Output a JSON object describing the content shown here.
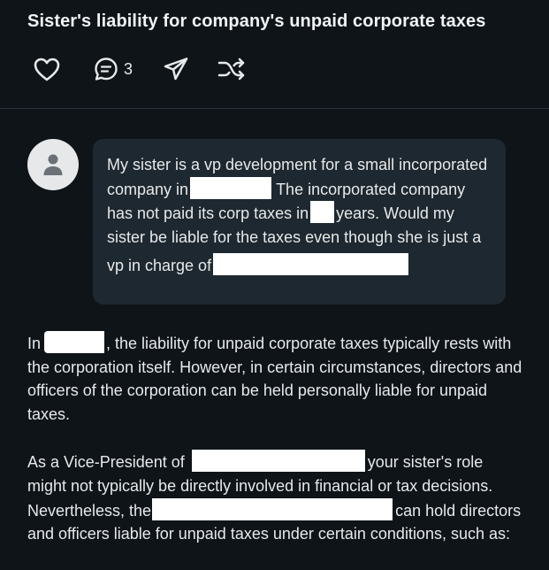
{
  "header": {
    "title": "Sister's liability for company's unpaid corporate taxes",
    "actions": {
      "like_icon": "heart-icon",
      "comment_icon": "comment-bubble-icon",
      "comment_count": "3",
      "share_icon": "send-icon",
      "alt_icon": "shuffle-icon"
    }
  },
  "question": {
    "avatar_icon": "user-icon",
    "segments": {
      "s1": "My sister is a vp  development for a small incorporated company in",
      "s2": "The incorporated company has not paid its corp taxes in",
      "s3": "years. Would my sister be liable for the taxes even though she is just a vp in charge of"
    }
  },
  "answer": {
    "p1": {
      "a": "In",
      "b": ", the liability for unpaid corporate taxes typically rests with the corporation itself. However, in certain circumstances, directors and officers of the corporation can be held personally liable for unpaid taxes."
    },
    "p2": {
      "a": "As a Vice-President of",
      "b": "your sister's role might not typically be directly involved in financial or tax decisions. Nevertheless, the",
      "c": "can hold directors and officers liable for unpaid taxes under certain conditions, such as:"
    }
  },
  "colors": {
    "background": "#0f1419",
    "bubble": "#1e2830",
    "text": "#e7e9ea",
    "redaction": "#ffffff"
  }
}
